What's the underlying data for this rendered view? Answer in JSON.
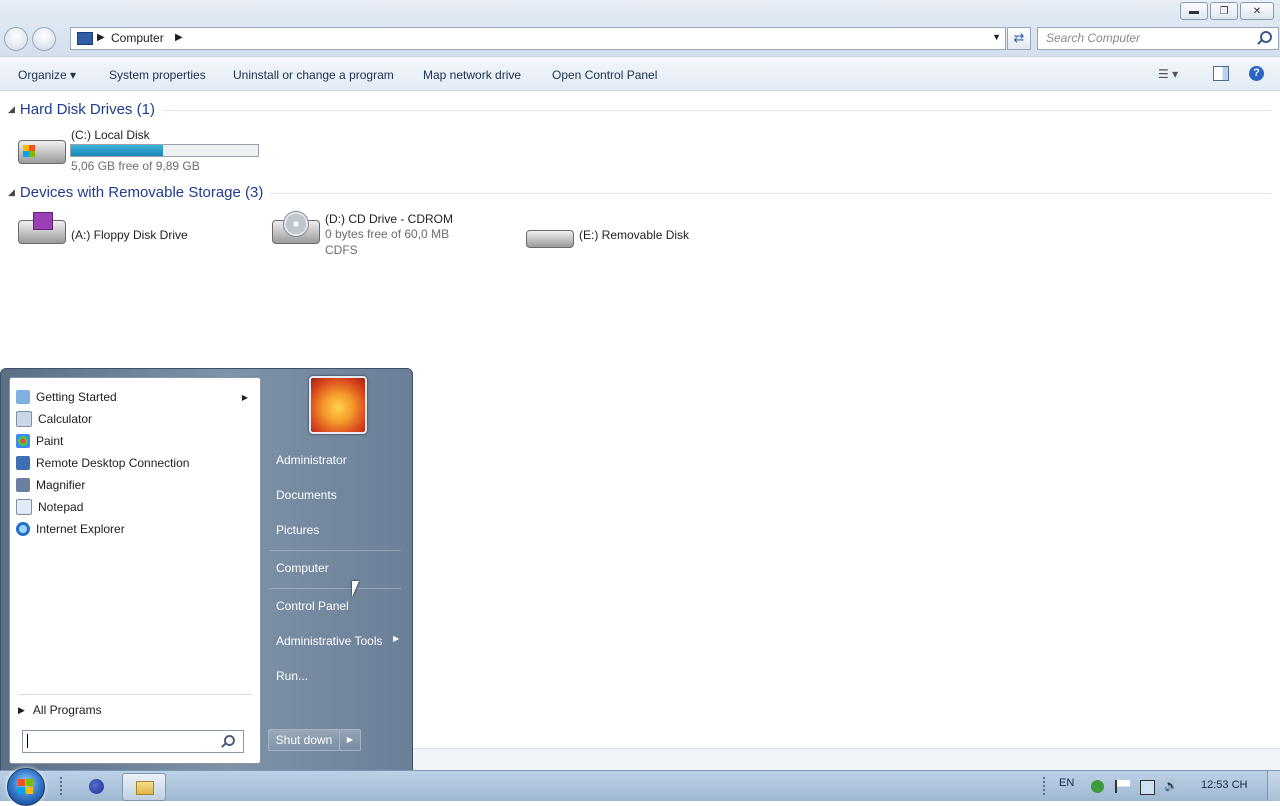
{
  "window": {
    "controls": [
      "minimize",
      "restore",
      "close"
    ]
  },
  "address": {
    "crumb": "Computer",
    "search_placeholder": "Search Computer"
  },
  "toolbar": {
    "organize": "Organize",
    "system_properties": "System properties",
    "uninstall": "Uninstall or change a program",
    "map_drive": "Map network drive",
    "open_control_panel": "Open Control Panel"
  },
  "groups": {
    "hard_disks": {
      "title": "Hard Disk Drives (1)",
      "items": [
        {
          "name": "(C:) Local Disk",
          "free": "5,06 GB free of 9,89 GB",
          "used_fraction": 0.49
        }
      ]
    },
    "removable": {
      "title": "Devices with Removable Storage (3)",
      "items": [
        {
          "name": "(A:) Floppy Disk Drive"
        },
        {
          "name": "(D:) CD Drive - CDROM",
          "free": "0 bytes free of 60,0 MB",
          "fs": "CDFS"
        },
        {
          "name": "(E:) Removable Disk"
        }
      ]
    }
  },
  "start_menu": {
    "programs": [
      {
        "label": "Getting Started",
        "icon": "getting-started-icon",
        "submenu": true
      },
      {
        "label": "Calculator",
        "icon": "calculator-icon"
      },
      {
        "label": "Paint",
        "icon": "paint-icon"
      },
      {
        "label": "Remote Desktop Connection",
        "icon": "remote-desktop-icon"
      },
      {
        "label": "Magnifier",
        "icon": "magnifier-icon"
      },
      {
        "label": "Notepad",
        "icon": "notepad-icon"
      },
      {
        "label": "Internet Explorer",
        "icon": "internet-explorer-icon"
      }
    ],
    "all_programs": "All Programs",
    "right": {
      "user": "Administrator",
      "documents": "Documents",
      "pictures": "Pictures",
      "computer": "Computer",
      "control_panel": "Control Panel",
      "admin_tools": "Administrative Tools",
      "run": "Run..."
    },
    "shutdown": "Shut down"
  },
  "taskbar": {
    "language": "EN",
    "clock": "12:53 CH"
  }
}
